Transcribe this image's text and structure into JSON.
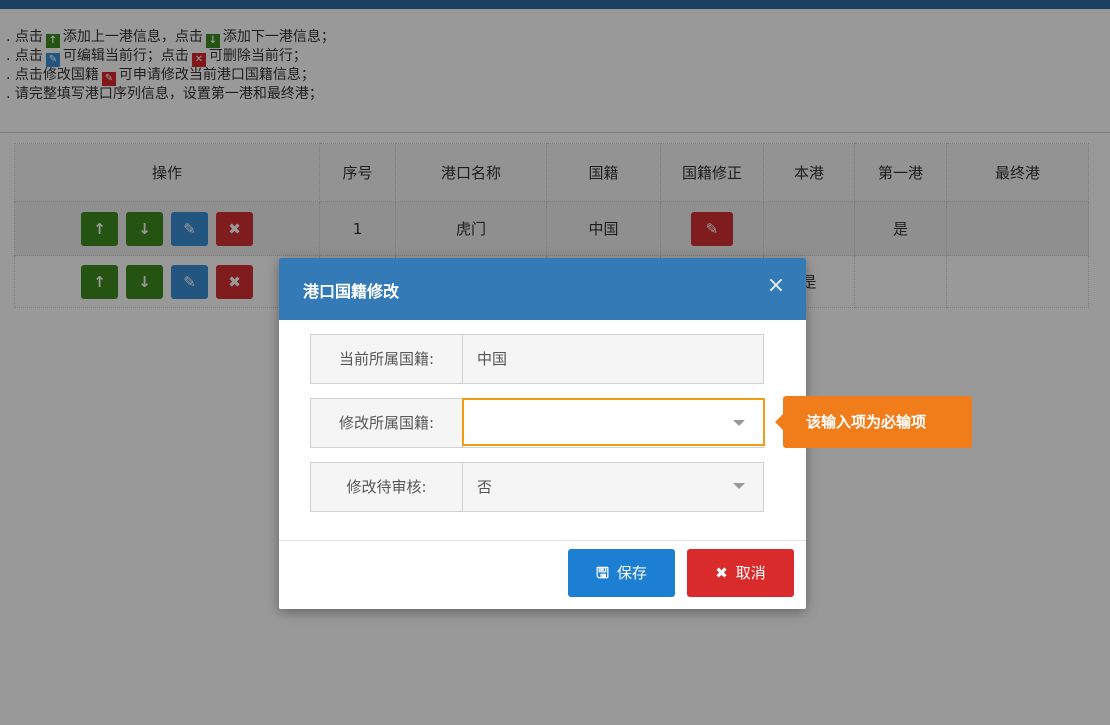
{
  "notes": {
    "line1_a": ". 点击",
    "line1_b": "添加上一港信息，点击",
    "line1_c": "添加下一港信息；",
    "line2_a": ". 点击",
    "line2_b": "可编辑当前行；点击",
    "line2_c": "可删除当前行；",
    "line3_a": ". 点击修改国籍",
    "line3_b": "可申请修改当前港口国籍信息；",
    "line4": ". 请完整填写港口序列信息，设置第一港和最终港；"
  },
  "table": {
    "headers": [
      "操作",
      "序号",
      "港口名称",
      "国籍",
      "国籍修正",
      "本港",
      "第一港",
      "最终港"
    ],
    "rows": [
      {
        "seq": "1",
        "port": "虎门",
        "nation": "中国",
        "this_port": "",
        "first": "是",
        "last": ""
      },
      {
        "seq": "",
        "port": "",
        "nation": "",
        "this_port": "是",
        "first": "",
        "last": ""
      }
    ]
  },
  "modal": {
    "title": "港口国籍修改",
    "close": "×",
    "current_label": "当前所属国籍:",
    "current_value": "中国",
    "modify_label": "修改所属国籍:",
    "modify_value": "",
    "pending_label": "修改待审核:",
    "pending_value": "否",
    "tooltip": "该输入项为必输项",
    "save_label": "保存",
    "cancel_label": "取消"
  },
  "colors": {
    "header_blue": "#337ab7",
    "save_blue": "#1d7fd1",
    "cancel_red": "#d92b2b",
    "tooltip_orange": "#f07d1a",
    "add_green": "#3d8a1e"
  },
  "icons": {
    "add_prev": "arrow-up-icon",
    "add_next": "arrow-down-icon",
    "edit": "edit-icon",
    "delete": "delete-icon",
    "save": "floppy-icon",
    "cancel": "x-icon"
  }
}
